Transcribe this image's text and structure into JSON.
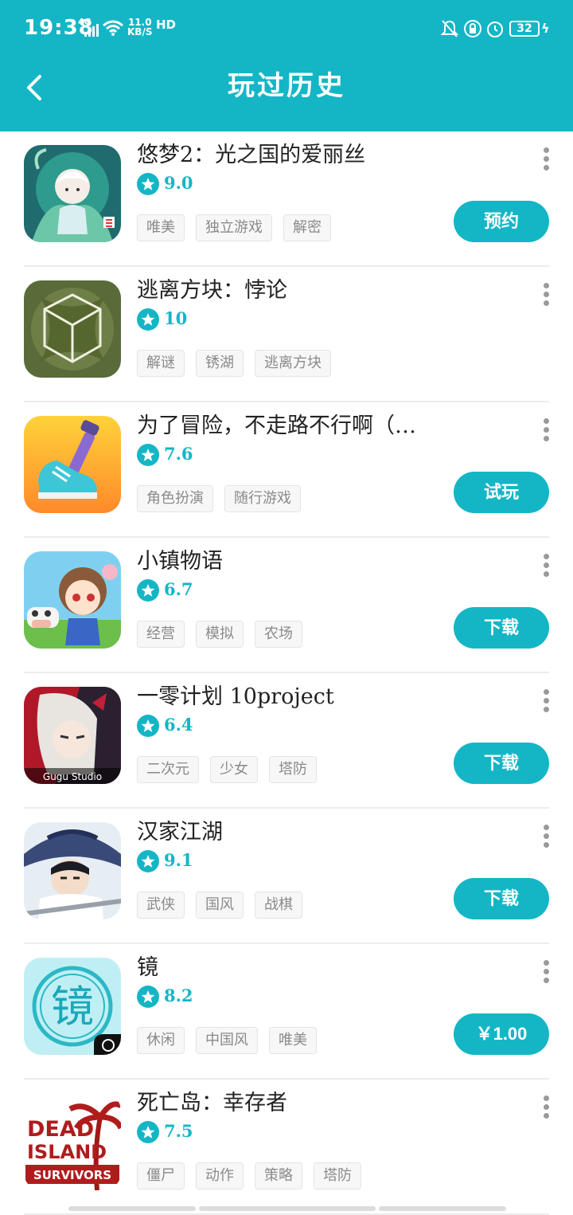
{
  "status_bar": {
    "time": "19:38",
    "network": "4G",
    "speed_value": "11.0",
    "speed_unit": "KB/S",
    "hd": "HD",
    "battery": "32"
  },
  "header": {
    "title": "玩过历史"
  },
  "colors": {
    "accent": "#14b6c6"
  },
  "games": [
    {
      "name": "悠梦2：光之国的爱丽丝",
      "score": "9.0",
      "tags": [
        "唯美",
        "独立游戏",
        "解密"
      ],
      "action": "预约"
    },
    {
      "name": "逃离方块：悖论",
      "score": "10",
      "tags": [
        "解谜",
        "锈湖",
        "逃离方块"
      ],
      "action": ""
    },
    {
      "name": "为了冒险，不走路不行啊（…",
      "score": "7.6",
      "tags": [
        "角色扮演",
        "随行游戏"
      ],
      "action": "试玩"
    },
    {
      "name": "小镇物语",
      "score": "6.7",
      "tags": [
        "经营",
        "模拟",
        "农场"
      ],
      "action": "下载"
    },
    {
      "name": "一零计划 10project",
      "score": "6.4",
      "tags": [
        "二次元",
        "少女",
        "塔防"
      ],
      "action": "下载"
    },
    {
      "name": "汉家江湖",
      "score": "9.1",
      "tags": [
        "武侠",
        "国风",
        "战棋"
      ],
      "action": "下载"
    },
    {
      "name": "镜",
      "score": "8.2",
      "tags": [
        "休闲",
        "中国风",
        "唯美"
      ],
      "action": "￥1.00"
    },
    {
      "name": "死亡岛：幸存者",
      "score": "7.5",
      "tags": [
        "僵尸",
        "动作",
        "策略",
        "塔防"
      ],
      "action": ""
    }
  ],
  "icon_art": {
    "gugu": "Gugu Studio",
    "dead": "DEAD",
    "island": "ISLAND",
    "survivors": "SURVIVORS",
    "mirror_char": "镜"
  }
}
